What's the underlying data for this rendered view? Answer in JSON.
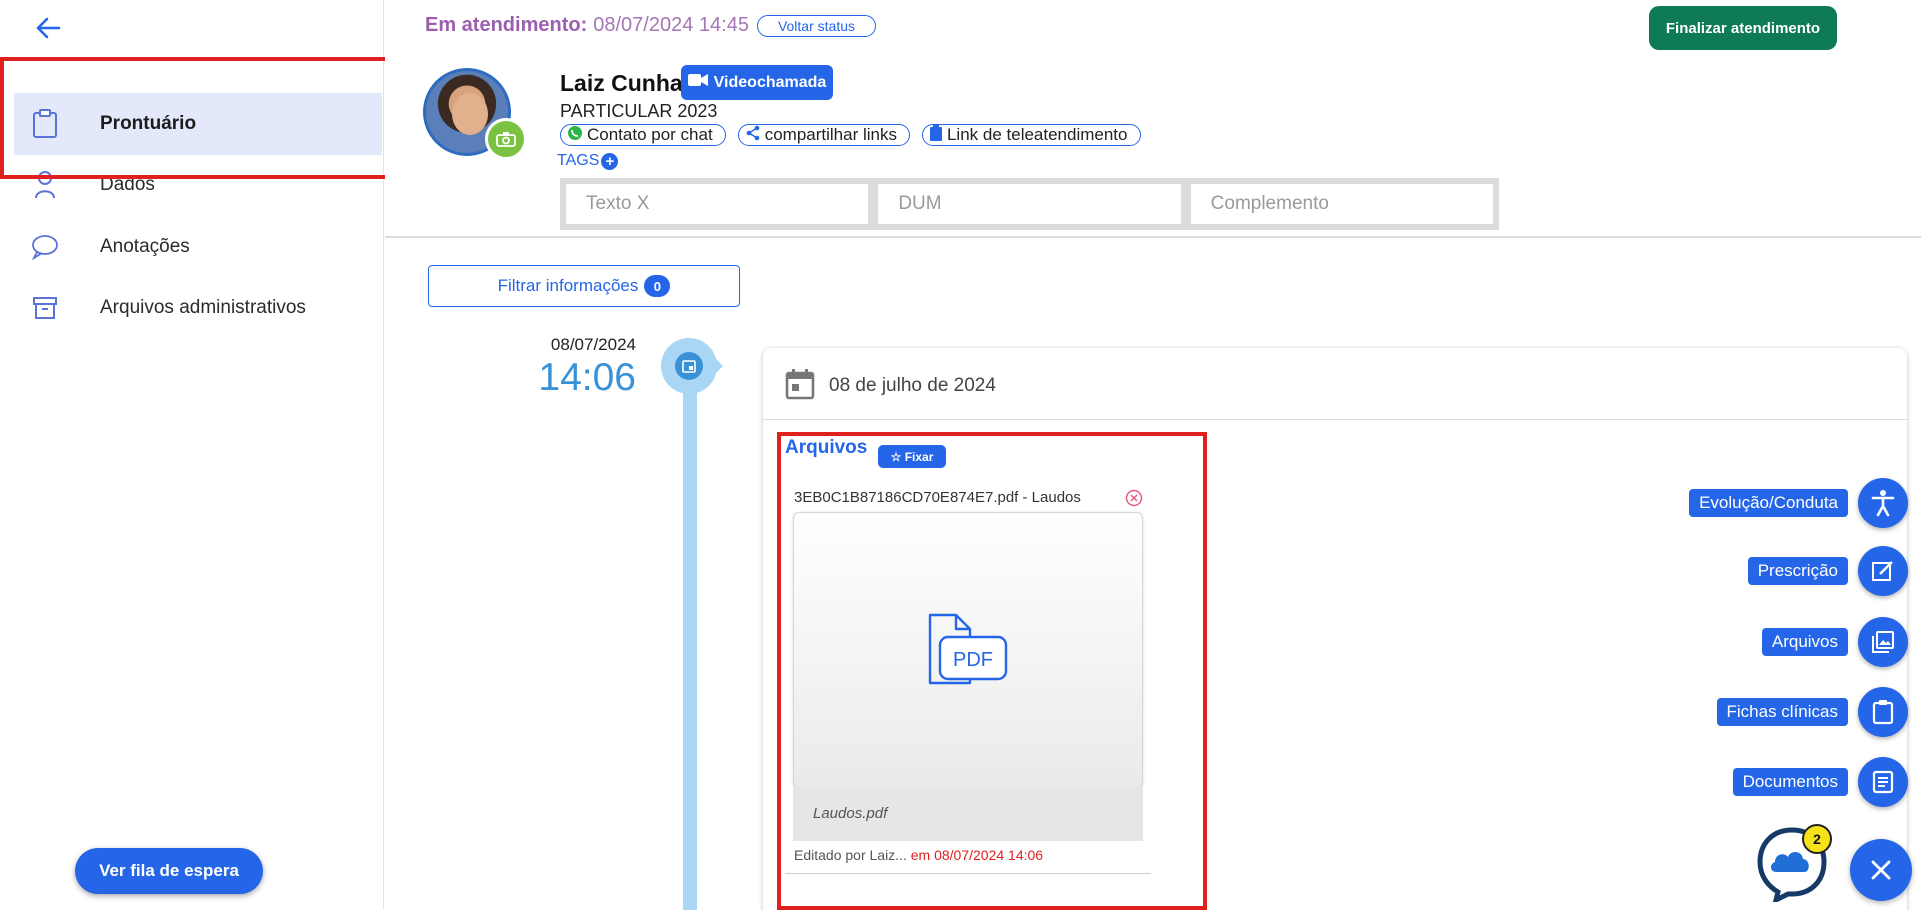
{
  "sidebar": {
    "items": [
      {
        "label": "Prontuário",
        "icon": "clipboard-icon",
        "active": true
      },
      {
        "label": "Dados",
        "icon": "person-icon",
        "active": false
      },
      {
        "label": "Anotações",
        "icon": "chat-bubble-icon",
        "active": false
      },
      {
        "label": "Arquivos administrativos",
        "icon": "archive-box-icon",
        "active": false
      }
    ],
    "queue_button": "Ver fila de espera"
  },
  "header": {
    "status_label": "Em atendimento:",
    "status_datetime": "08/07/2024 14:45",
    "back_status_button": "Voltar status",
    "finish_button": "Finalizar atendimento",
    "patient_name": "Laiz Cunha",
    "video_button": "Videochamada",
    "plan": "PARTICULAR 2023",
    "chips": {
      "chat": "Contato por chat",
      "share": "compartilhar links",
      "telehealth": "Link de teleatendimento"
    },
    "tags_label": "TAGS",
    "fields": {
      "texto_x_placeholder": "Texto X",
      "dum_placeholder": "DUM",
      "complemento_placeholder": "Complemento"
    }
  },
  "filter": {
    "label": "Filtrar informações",
    "count": "0"
  },
  "timeline": {
    "date": "08/07/2024",
    "time": "14:06"
  },
  "card": {
    "date_title": "08 de julho de 2024",
    "files_title": "Arquivos",
    "pin_button": "☆ Fixar",
    "file_name": "3EB0C1B87186CD70E874E7.pdf - Laudos",
    "file_caption": "Laudos.pdf",
    "pdf_label": "PDF",
    "edited_by": "Editado por Laiz...",
    "edited_at": "em 08/07/2024 14:06"
  },
  "actions": [
    {
      "label": "Evolução/Conduta",
      "icon": "accessibility-icon"
    },
    {
      "label": "Prescrição",
      "icon": "edit-note-icon"
    },
    {
      "label": "Arquivos",
      "icon": "images-icon"
    },
    {
      "label": "Fichas clínicas",
      "icon": "clipboard-icon"
    },
    {
      "label": "Documentos",
      "icon": "document-icon"
    }
  ],
  "chat_badge_count": "2",
  "colors": {
    "primary": "#2566e8",
    "finish": "#0e7a57",
    "status": "#9b5fae",
    "highlight": "#e01f1f",
    "timeline": "#a9d6f5"
  }
}
